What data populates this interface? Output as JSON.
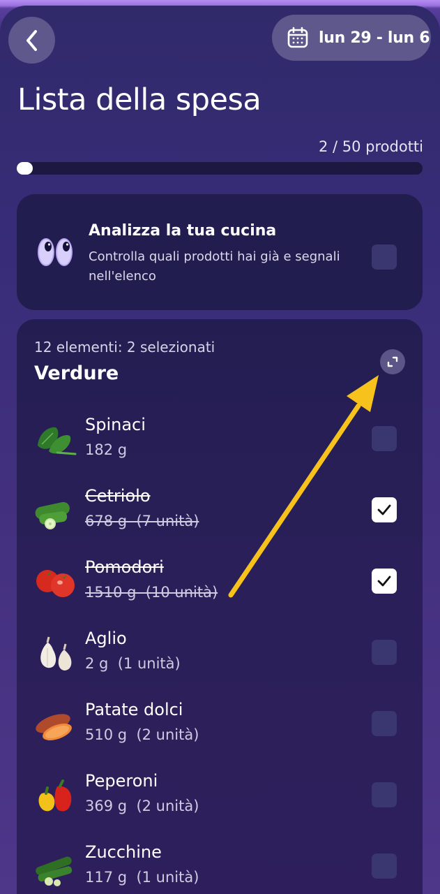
{
  "header": {
    "date_range": "lun 29 - lun 6",
    "title": "Lista della spesa",
    "product_count": "2 / 50 prodotti",
    "progress_fraction": 0.04
  },
  "analyze_card": {
    "title": "Analizza la tua cucina",
    "description": "Controlla quali prodotti hai già e segnali nell'elenco",
    "checked": false
  },
  "category": {
    "summary": "12 elementi: 2 selezionati",
    "name": "Verdure",
    "items": [
      {
        "name": "Spinaci",
        "qty": "182 g",
        "checked": false,
        "icon": "spinach-icon"
      },
      {
        "name": "Cetriolo",
        "qty": "678 g  (7 unità)",
        "checked": true,
        "icon": "cucumber-icon"
      },
      {
        "name": "Pomodori",
        "qty": "1510 g  (10 unità)",
        "checked": true,
        "icon": "tomato-icon"
      },
      {
        "name": "Aglio",
        "qty": "2 g  (1 unità)",
        "checked": false,
        "icon": "garlic-icon"
      },
      {
        "name": "Patate dolci",
        "qty": "510 g  (2 unità)",
        "checked": false,
        "icon": "sweet-potato-icon"
      },
      {
        "name": "Peperoni",
        "qty": "369 g  (2 unità)",
        "checked": false,
        "icon": "pepper-icon"
      },
      {
        "name": "Zucchine",
        "qty": "117 g  (1 unità)",
        "checked": false,
        "icon": "zucchini-icon"
      }
    ]
  },
  "colors": {
    "accent_arrow": "#f7c21b",
    "card_bg": "#221d4f",
    "checkbox_empty": "#3a3670"
  }
}
